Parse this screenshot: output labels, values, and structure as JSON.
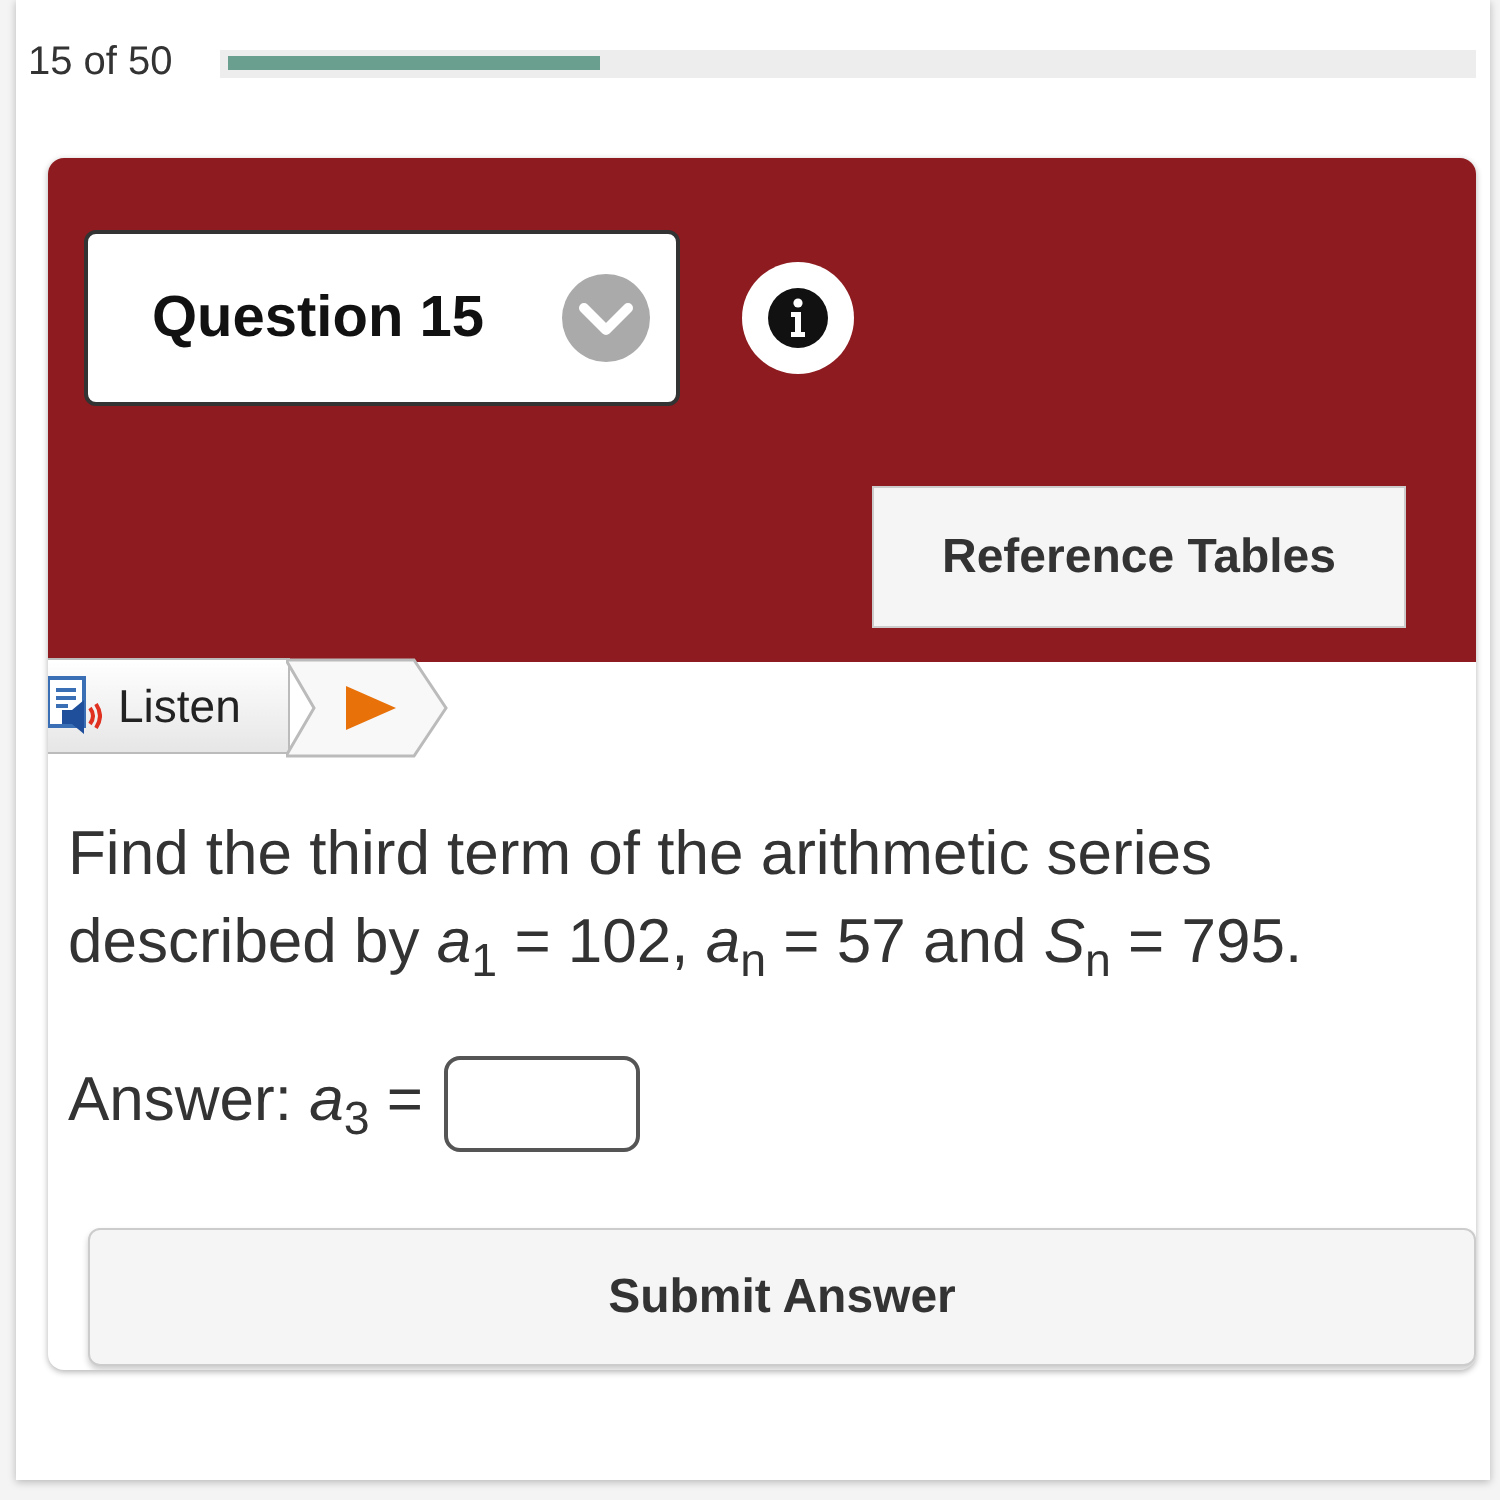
{
  "progress": {
    "label": "15 of 50",
    "level": 0.3
  },
  "question": {
    "title": "Question 15",
    "reference_button": "Reference Tables"
  },
  "listen": {
    "label": "Listen"
  },
  "prompt": "Find the third term of the arithmetic series described by *a*$_{1}$ = 102, *a*$_{n}$ = 57 and *S*$_{n}$ = 795.",
  "answer": {
    "label": "Answer: *a*$_{3}$ ="
  },
  "submit_button": "Submit Answer"
}
